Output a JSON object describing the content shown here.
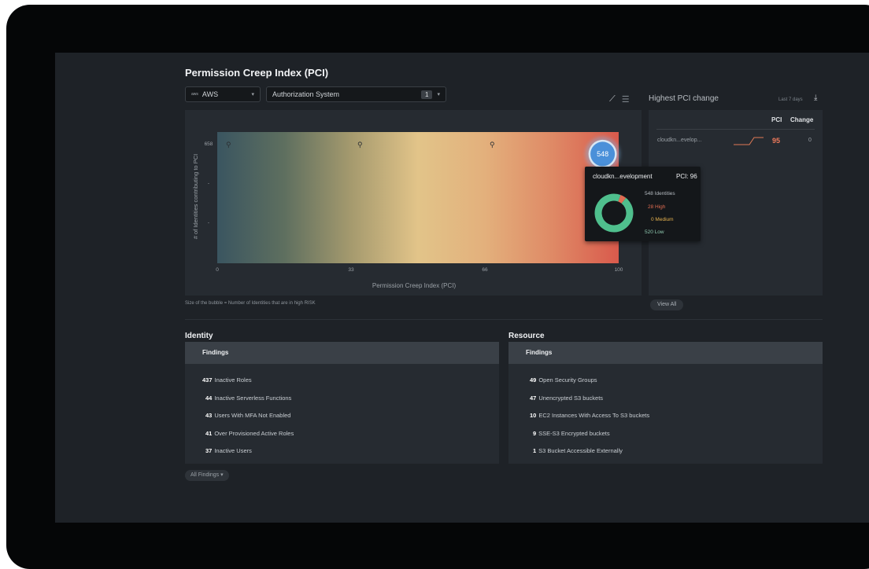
{
  "header": {
    "title": "Permission Creep Index (PCI)"
  },
  "filters": {
    "provider_logo": "aws",
    "provider": "AWS",
    "system": "Authorization System",
    "system_count": "1"
  },
  "chart_data": {
    "type": "scatter",
    "title": "",
    "xlabel": "Permission Creep Index (PCI)",
    "ylabel": "# of Identities contributing to PCI",
    "x_ticks": [
      "0",
      "33",
      "66",
      "100"
    ],
    "y_ticks": [
      "658",
      "-",
      "-"
    ],
    "xlim": [
      0,
      100
    ],
    "ylim": [
      0,
      658
    ],
    "gradient_colors": [
      "#3a5560",
      "#5e6f5f",
      "#a59a6e",
      "#e2c489",
      "#e3b07c",
      "#df8a66",
      "#d95a4c"
    ],
    "points": [
      {
        "label": "548",
        "x": 96,
        "y": 548,
        "color": "#4a90d9"
      }
    ]
  },
  "chart_note": "Size of the bubble = Number of Identities that are in high RISK",
  "tooltip": {
    "title": "cloudkn...evelopment",
    "pci": "PCI: 96",
    "identities": "548 Identities",
    "high": "28 High",
    "medium": "0 Medium",
    "low": "520 Low",
    "donut": [
      {
        "name": "High",
        "value": 28,
        "color": "#e06c52"
      },
      {
        "name": "Medium",
        "value": 0,
        "color": "#e6b24f"
      },
      {
        "name": "Low",
        "value": 520,
        "color": "#4fbf8d"
      }
    ]
  },
  "pci_change": {
    "title": "Highest PCI change",
    "subtitle": "Last 7 days",
    "col_pci": "PCI",
    "col_change": "Change",
    "rows": [
      {
        "name": "cloudkn...evelop...",
        "pci": "95",
        "change": "0"
      }
    ],
    "view_all": "View All"
  },
  "identity": {
    "title": "Identity",
    "findings_header": "Findings",
    "items": [
      {
        "count": "437",
        "label": "Inactive Roles"
      },
      {
        "count": "44",
        "label": "Inactive Serverless Functions"
      },
      {
        "count": "43",
        "label": "Users With MFA Not Enabled"
      },
      {
        "count": "41",
        "label": "Over Provisioned Active Roles"
      },
      {
        "count": "37",
        "label": "Inactive Users"
      }
    ]
  },
  "resource": {
    "title": "Resource",
    "findings_header": "Findings",
    "items": [
      {
        "count": "49",
        "label": "Open Security Groups"
      },
      {
        "count": "47",
        "label": "Unencrypted S3 buckets"
      },
      {
        "count": "10",
        "label": "EC2 Instances With Access To S3 buckets"
      },
      {
        "count": "9",
        "label": "SSE-S3 Encrypted buckets"
      },
      {
        "count": "1",
        "label": "S3 Bucket Accessible Externally"
      }
    ]
  },
  "all_findings": "All Findings",
  "colors": {
    "accent_blue": "#4a90d9",
    "high": "#e06c52",
    "low": "#4fbf8d",
    "pci_value": "#ee7a5c"
  }
}
